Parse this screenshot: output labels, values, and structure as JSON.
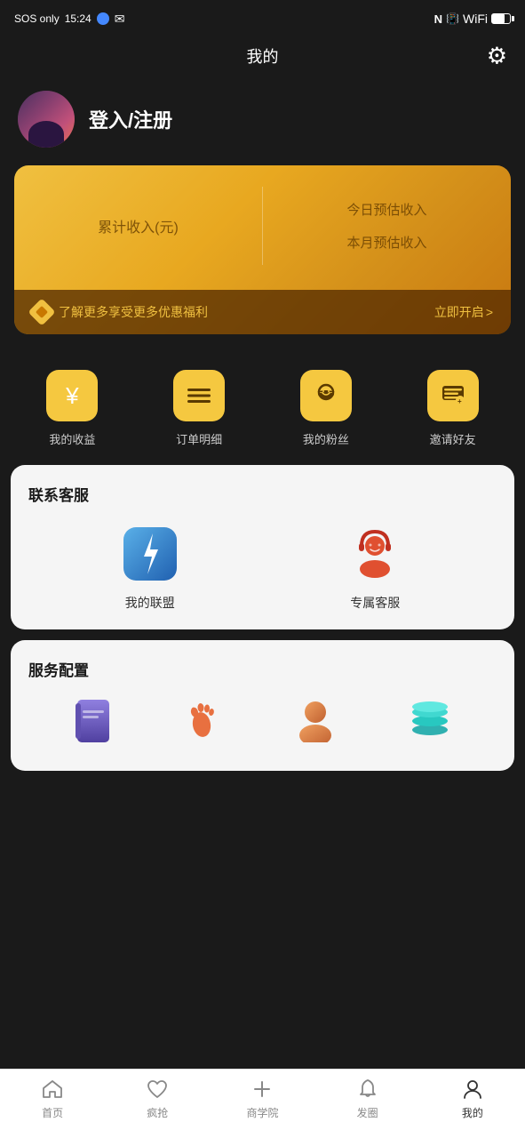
{
  "statusBar": {
    "leftText": "SOS only",
    "time": "15:24",
    "rightIcons": [
      "nfc",
      "vibrate",
      "wifi",
      "battery"
    ]
  },
  "header": {
    "title": "我的",
    "settingsLabel": "设置"
  },
  "user": {
    "loginLabel": "登入/注册"
  },
  "incomeCard": {
    "cumulativeLabel": "累计收入(元)",
    "todayLabel": "今日预估收入",
    "monthLabel": "本月预估收入",
    "promoText": "了解更多享受更多优惠福利",
    "promoBtn": "立即开启",
    "promoBtnArrow": ">"
  },
  "iconGrid": {
    "items": [
      {
        "icon": "¥",
        "label": "我的收益"
      },
      {
        "icon": "≡",
        "label": "订单明细"
      },
      {
        "icon": "☺",
        "label": "我的粉丝"
      },
      {
        "icon": "≡",
        "label": "邀请好友"
      }
    ]
  },
  "contactSection": {
    "title": "联系客服",
    "items": [
      {
        "label": "我的联盟"
      },
      {
        "label": "专属客服"
      }
    ]
  },
  "serviceSection": {
    "title": "服务配置"
  },
  "bottomNav": {
    "items": [
      {
        "label": "首页",
        "active": false
      },
      {
        "label": "疯抢",
        "active": false
      },
      {
        "label": "商学院",
        "active": false
      },
      {
        "label": "发圈",
        "active": false
      },
      {
        "label": "我的",
        "active": true
      }
    ]
  }
}
